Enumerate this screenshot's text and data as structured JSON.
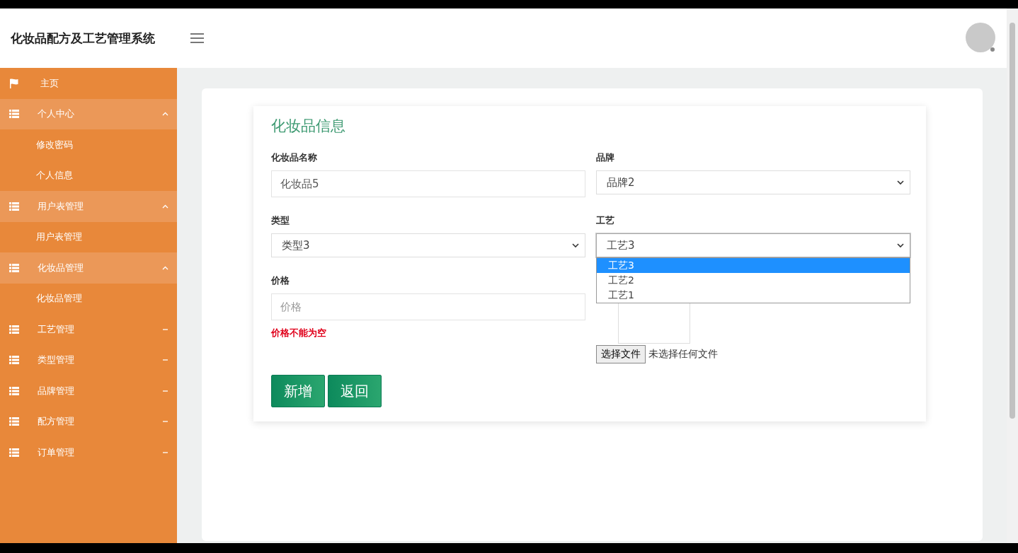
{
  "header": {
    "title": "化妆品配方及工艺管理系统"
  },
  "sidebar": {
    "items": [
      {
        "label": "主页",
        "kind": "home"
      },
      {
        "label": "个人中心",
        "kind": "group",
        "expanded": true,
        "children": [
          {
            "label": "修改密码"
          },
          {
            "label": "个人信息"
          }
        ]
      },
      {
        "label": "用户表管理",
        "kind": "group",
        "expanded": true,
        "children": [
          {
            "label": "用户表管理"
          }
        ]
      },
      {
        "label": "化妆品管理",
        "kind": "group",
        "expanded": true,
        "children": [
          {
            "label": "化妆品管理"
          }
        ]
      },
      {
        "label": "工艺管理",
        "kind": "group",
        "expanded": false
      },
      {
        "label": "类型管理",
        "kind": "group",
        "expanded": false
      },
      {
        "label": "品牌管理",
        "kind": "group",
        "expanded": false
      },
      {
        "label": "配方管理",
        "kind": "group",
        "expanded": false
      },
      {
        "label": "订单管理",
        "kind": "group",
        "expanded": false
      }
    ]
  },
  "form": {
    "title": "化妆品信息",
    "fields": [
      {
        "label": "化妆品名称",
        "kind": "text",
        "value": "化妆品5"
      },
      {
        "label": "品牌",
        "kind": "select",
        "value": "品牌2",
        "expanded": false
      },
      {
        "label": "类型",
        "kind": "select",
        "value": "类型3",
        "expanded": false
      },
      {
        "label": "工艺",
        "kind": "select",
        "value": "工艺3",
        "expanded": true,
        "options": [
          {
            "label": "工艺3",
            "selected": true
          },
          {
            "label": "工艺2",
            "selected": false
          },
          {
            "label": "工艺1",
            "selected": false
          }
        ]
      },
      {
        "label": "价格",
        "kind": "text",
        "placeholder": "价格",
        "error": "价格不能为空"
      },
      {
        "kind": "file",
        "button": "选择文件",
        "status": "未选择任何文件"
      }
    ],
    "buttons": [
      "新增",
      "返回"
    ]
  }
}
